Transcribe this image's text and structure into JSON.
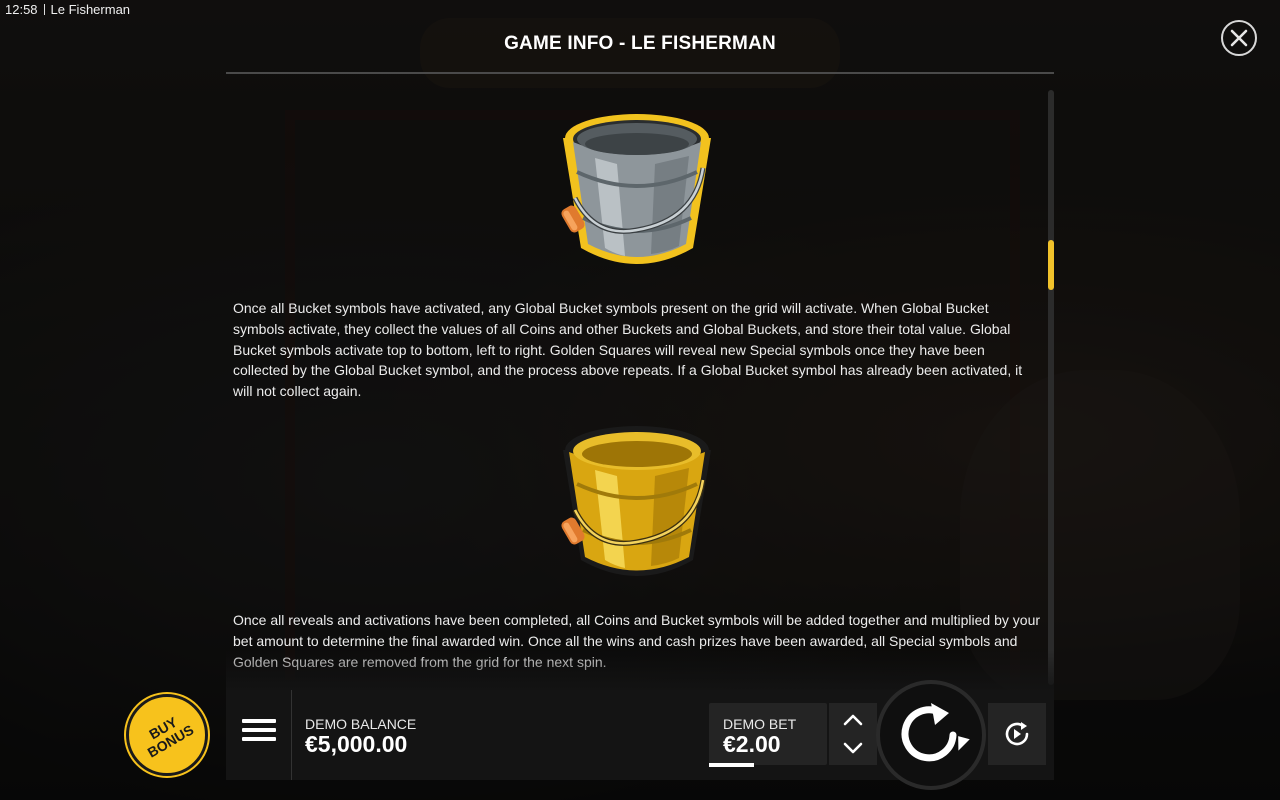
{
  "status_bar": {
    "time": "12:58",
    "app_name": "Le Fisherman"
  },
  "info": {
    "title": "GAME INFO - LE FISHERMAN",
    "paragraphs": [
      "Once all Bucket symbols have activated, any Global Bucket symbols present on the grid will activate. When Global Bucket symbols activate, they collect the values of all Coins and other Buckets and Global Buckets, and store their total value. Global Bucket symbols activate top to bottom, left to right. Golden Squares will reveal new Special symbols once they have been collected by the Global Bucket symbol, and the process above repeats. If a Global Bucket symbol has already been activated, it will not collect again.",
      "Once all reveals and activations have been completed, all Coins and Bucket symbols will be added together and multiplied by your bet amount to determine the final awarded win. Once all the wins and cash prizes have been awarded, all Special symbols and Golden Squares are removed from the grid for the next spin."
    ],
    "symbols": [
      "bucket-icon",
      "global-bucket-icon"
    ]
  },
  "controls": {
    "buy_bonus_line1": "BUY",
    "buy_bonus_line2": "BONUS",
    "balance_label": "DEMO BALANCE",
    "balance_value": "€5,000.00",
    "bet_label": "DEMO BET",
    "bet_value": "€2.00"
  },
  "colors": {
    "accent": "#f7c21c",
    "panel": "#141414",
    "text": "#ececec"
  }
}
